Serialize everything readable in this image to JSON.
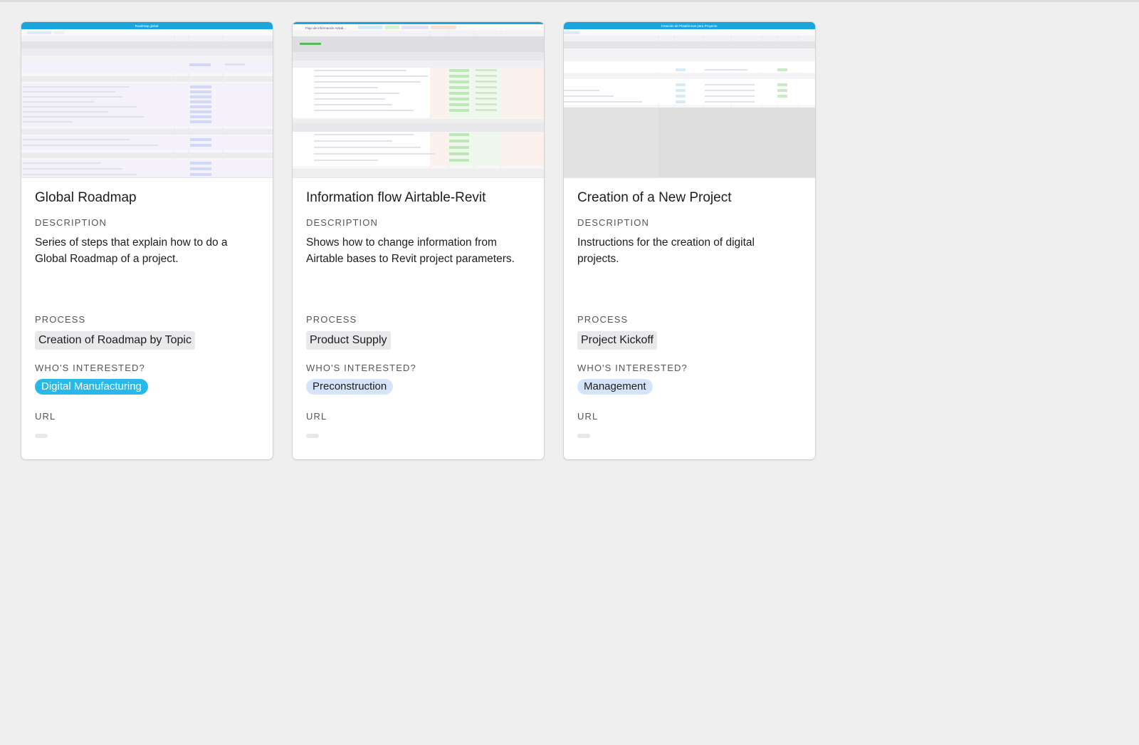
{
  "labels": {
    "description": "DESCRIPTION",
    "process": "PROCESS",
    "whos_interested": "WHO'S INTERESTED?",
    "url": "URL"
  },
  "cards": [
    {
      "title": "Global Roadmap",
      "thumbnail_title": "Roadmap global",
      "description": "Series of steps that explain how to do a Global Roadmap of a project.",
      "process": "Creation of Roadmap by Topic",
      "interested": "Digital Manufacturing",
      "interested_bg": "#29b8ea",
      "interested_fg": "#ffffff",
      "url": ""
    },
    {
      "title": "Information flow Airtable-Revit",
      "thumbnail_title": "Flujo de información Airtab...",
      "description": "Shows how to change information from Airtable bases to Revit project parameters.",
      "process": "Product Supply",
      "interested": "Preconstruction",
      "interested_bg": "#d6e4fb",
      "interested_fg": "#1d1d1f",
      "url": ""
    },
    {
      "title": "Creation of a New Project",
      "thumbnail_title": "Creación de Plataformas para Proyecto",
      "description": "Instructions for the creation of digital projects.",
      "process": "Project Kickoff",
      "interested": "Management",
      "interested_bg": "#d6e4fb",
      "interested_fg": "#1d1d1f",
      "url": ""
    }
  ],
  "colors": {
    "background": "#efefef",
    "header_blue": "#1aa6dd",
    "pill_gray": "#e9e9ec"
  }
}
